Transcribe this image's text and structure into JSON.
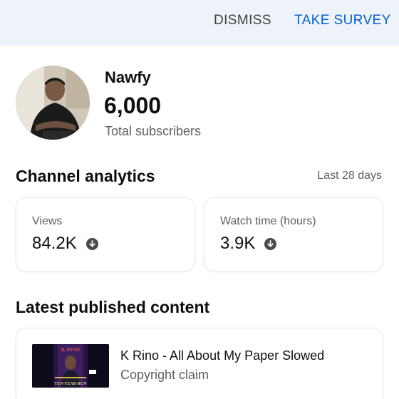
{
  "survey": {
    "dismiss_label": "DISMISS",
    "take_survey_label": "TAKE SURVEY"
  },
  "channel": {
    "name": "Nawfy",
    "subscribers": "6,000",
    "subscribers_label": "Total subscribers"
  },
  "analytics": {
    "title": "Channel analytics",
    "range": "Last 28 days",
    "cards": [
      {
        "label": "Views",
        "value": "84.2K",
        "trend_icon": "arrow-down-circle-icon"
      },
      {
        "label": "Watch time (hours)",
        "value": "3.9K",
        "trend_icon": "arrow-down-circle-icon"
      }
    ]
  },
  "latest": {
    "title": "Latest published content",
    "video": {
      "title": "K Rino - All About My Paper Slowed",
      "status": "Copyright claim",
      "thumb_text": "K-RINO",
      "thumb_subtitle": "TEN YEAR RUN"
    }
  },
  "colors": {
    "accent": "#065fd4",
    "survey_bg": "#eef3f9",
    "secondary_text": "#606060"
  }
}
